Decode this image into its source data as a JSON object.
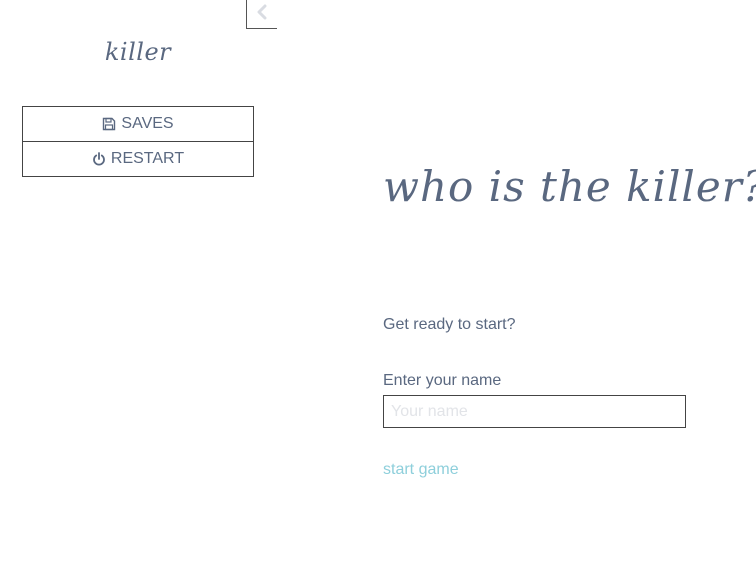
{
  "sidebar": {
    "toggle_icon": "chevron-left-icon",
    "story_title": "killer",
    "menu": {
      "saves_label": "SAVES",
      "saves_icon": "floppy-disk-icon",
      "restart_label": "RESTART",
      "restart_icon": "power-icon"
    }
  },
  "passage": {
    "title": "who is the killer?",
    "ready_text": "Get ready to start?",
    "name_label": "Enter your name",
    "name_input": {
      "value": "",
      "placeholder": "Your name"
    },
    "start_link": "start game"
  },
  "colors": {
    "text": "#5a6880",
    "link": "#8ecfdb",
    "placeholder": "#e2e4e8",
    "border": "#444444"
  }
}
